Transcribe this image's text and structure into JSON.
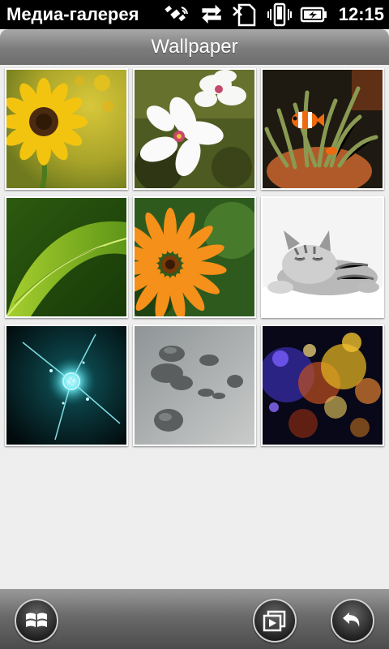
{
  "status_bar": {
    "app_title": "Медиа-галерея",
    "time": "12:15",
    "icons": [
      "satellite-icon",
      "data-transfer-icon",
      "no-sim-icon",
      "vibrate-icon",
      "battery-charging-icon"
    ]
  },
  "header": {
    "title": "Wallpaper"
  },
  "gallery": {
    "thumbnails": [
      {
        "subject": "sunflower"
      },
      {
        "subject": "white-flowers"
      },
      {
        "subject": "clownfish"
      },
      {
        "subject": "green-leaf"
      },
      {
        "subject": "orange-flower"
      },
      {
        "subject": "sleeping-kitten"
      },
      {
        "subject": "light-burst"
      },
      {
        "subject": "pebbles"
      },
      {
        "subject": "bokeh-lights"
      }
    ]
  },
  "bottom_bar": {
    "buttons": [
      "windows-start-icon",
      "slideshow-icon",
      "back-icon"
    ]
  }
}
